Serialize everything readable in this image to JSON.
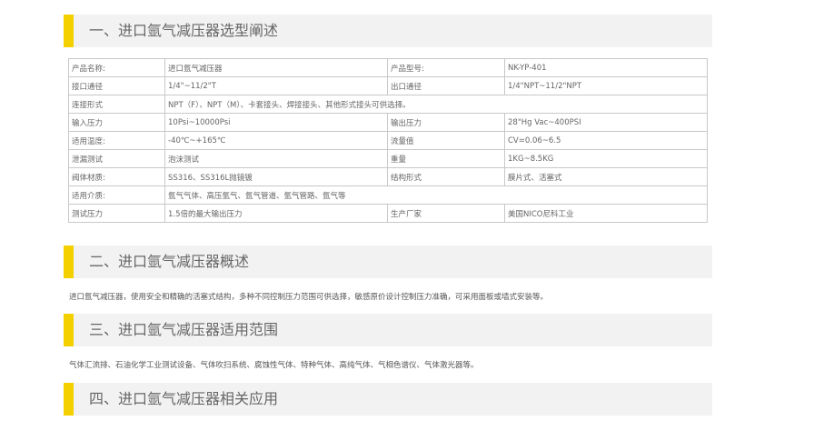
{
  "sections": [
    {
      "title": "一、进口氩气减压器选型阐述"
    },
    {
      "title": "二、进口氩气减压器概述"
    },
    {
      "title": "三、进口氩气减压器适用范围"
    },
    {
      "title": "四、进口氩气减压器相关应用"
    }
  ],
  "spec_table": {
    "rows": [
      [
        "产品名称:",
        "进口氩气减压器",
        "产品型号:",
        "NK-YP-401"
      ],
      [
        "接口通径",
        "1/4\"~11/2\"T",
        "出口通径",
        "1/4\"NPT~11/2\"NPT"
      ],
      [
        "连接形式",
        "NPT（F）、NPT（M）、卡套接头、焊接接头、其他形式接头可供选择。"
      ],
      [
        "输入压力",
        "10Psi~10000Psi",
        "输出压力",
        "28\"Hg Vac~400PSI"
      ],
      [
        "适用温度:",
        "-40℃~+165℃",
        "流量值",
        "CV=0.06~6.5"
      ],
      [
        "泄漏测试",
        "泡沫测试",
        "重量",
        "1KG~8.5KG"
      ],
      [
        "阀体材质:",
        "SS316、SS316L抛镜镀",
        "结构形式",
        "膜片式、活塞式"
      ],
      [
        "适用介质:",
        "氩气气体、高压氩气、氩气管道、氩气管路、氩气等"
      ],
      [
        "测试压力",
        "1.5倍的最大输出压力",
        "生产厂家",
        "美国NICO尼科工业"
      ]
    ]
  },
  "overview_text": "进口氩气减压器，使用安全和精确的活塞式结构，多种不同控制压力范围可供选择，敏感原价设计控制压力准确，可采用面板或墙式安装等。",
  "scope_text": "气体汇流排、石油化学工业测试设备、气体吹扫系统、腐蚀性气体、特种气体、高纯气体、气相色谱仪、气体激光器等。"
}
